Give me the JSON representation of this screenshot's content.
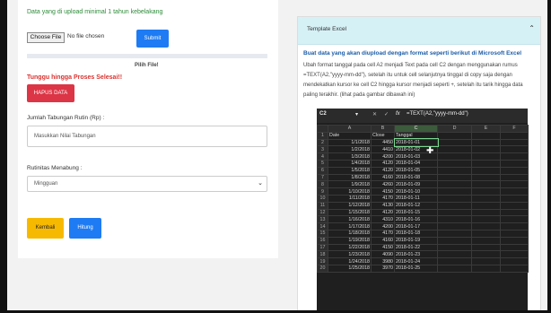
{
  "upload": {
    "title": "Data yang di upload minimal 1 tahun kebelakang",
    "file_button": "Choose File",
    "file_status": "No file chosen",
    "submit_label": "Submit",
    "hint": "Pilih File!"
  },
  "status": {
    "wait_text": "Tunggu hingga Proses Selesai!!",
    "delete_label": "HAPUS DATA"
  },
  "form": {
    "savings_label": "Jumlah Tabungan Rutin (Rp) :",
    "savings_placeholder": "Masukkan Nilai Tabungan",
    "routine_label": "Rutinitas Menabung :",
    "routine_value": "Mingguan",
    "back_label": "Kembali",
    "calc_label": "Hitung"
  },
  "template": {
    "header": "Template Excel",
    "desc_title": "Buat data yang akan diupload dengan format seperti berikut di Microsoft Excel",
    "desc_body": "Ubah format tanggal pada cell A2 menjadi Text pada cell C2 dengan menggunakan rumus =TEXT(A2,\"yyyy-mm-dd\"), setelah itu untuk cell selanjutnya tinggal di copy saja dengan mendekatkan kursor ke cell C2 hingga kursor menjadi seperti +, setelah itu tarik hingga data paling terakhir. (lihat pada gambar dibawah ini)"
  },
  "excel": {
    "name_box": "C2",
    "formula": "=TEXT(A2,\"yyyy-mm-dd\")",
    "columns": [
      "A",
      "B",
      "C",
      "D",
      "E",
      "F"
    ],
    "headers": [
      "Date",
      "Close",
      "Tanggal"
    ],
    "rows": [
      [
        "1/1/2018",
        "4450",
        "2018-01-01"
      ],
      [
        "1/2/2018",
        "4410",
        "2018-01-02"
      ],
      [
        "1/3/2018",
        "4200",
        "2018-01-03"
      ],
      [
        "1/4/2018",
        "4120",
        "2018-01-04"
      ],
      [
        "1/5/2018",
        "4120",
        "2018-01-05"
      ],
      [
        "1/8/2018",
        "4160",
        "2018-01-08"
      ],
      [
        "1/9/2018",
        "4260",
        "2018-01-09"
      ],
      [
        "1/10/2018",
        "4150",
        "2018-01-10"
      ],
      [
        "1/11/2018",
        "4170",
        "2018-01-11"
      ],
      [
        "1/12/2018",
        "4130",
        "2018-01-12"
      ],
      [
        "1/15/2018",
        "4120",
        "2018-01-15"
      ],
      [
        "1/16/2018",
        "4310",
        "2018-01-16"
      ],
      [
        "1/17/2018",
        "4200",
        "2018-01-17"
      ],
      [
        "1/18/2018",
        "4170",
        "2018-01-18"
      ],
      [
        "1/19/2018",
        "4160",
        "2018-01-19"
      ],
      [
        "1/22/2018",
        "4150",
        "2018-01-22"
      ],
      [
        "1/23/2018",
        "4090",
        "2018-01-23"
      ],
      [
        "1/24/2018",
        "3980",
        "2018-01-24"
      ],
      [
        "1/25/2018",
        "3970",
        "2018-01-25"
      ]
    ]
  }
}
